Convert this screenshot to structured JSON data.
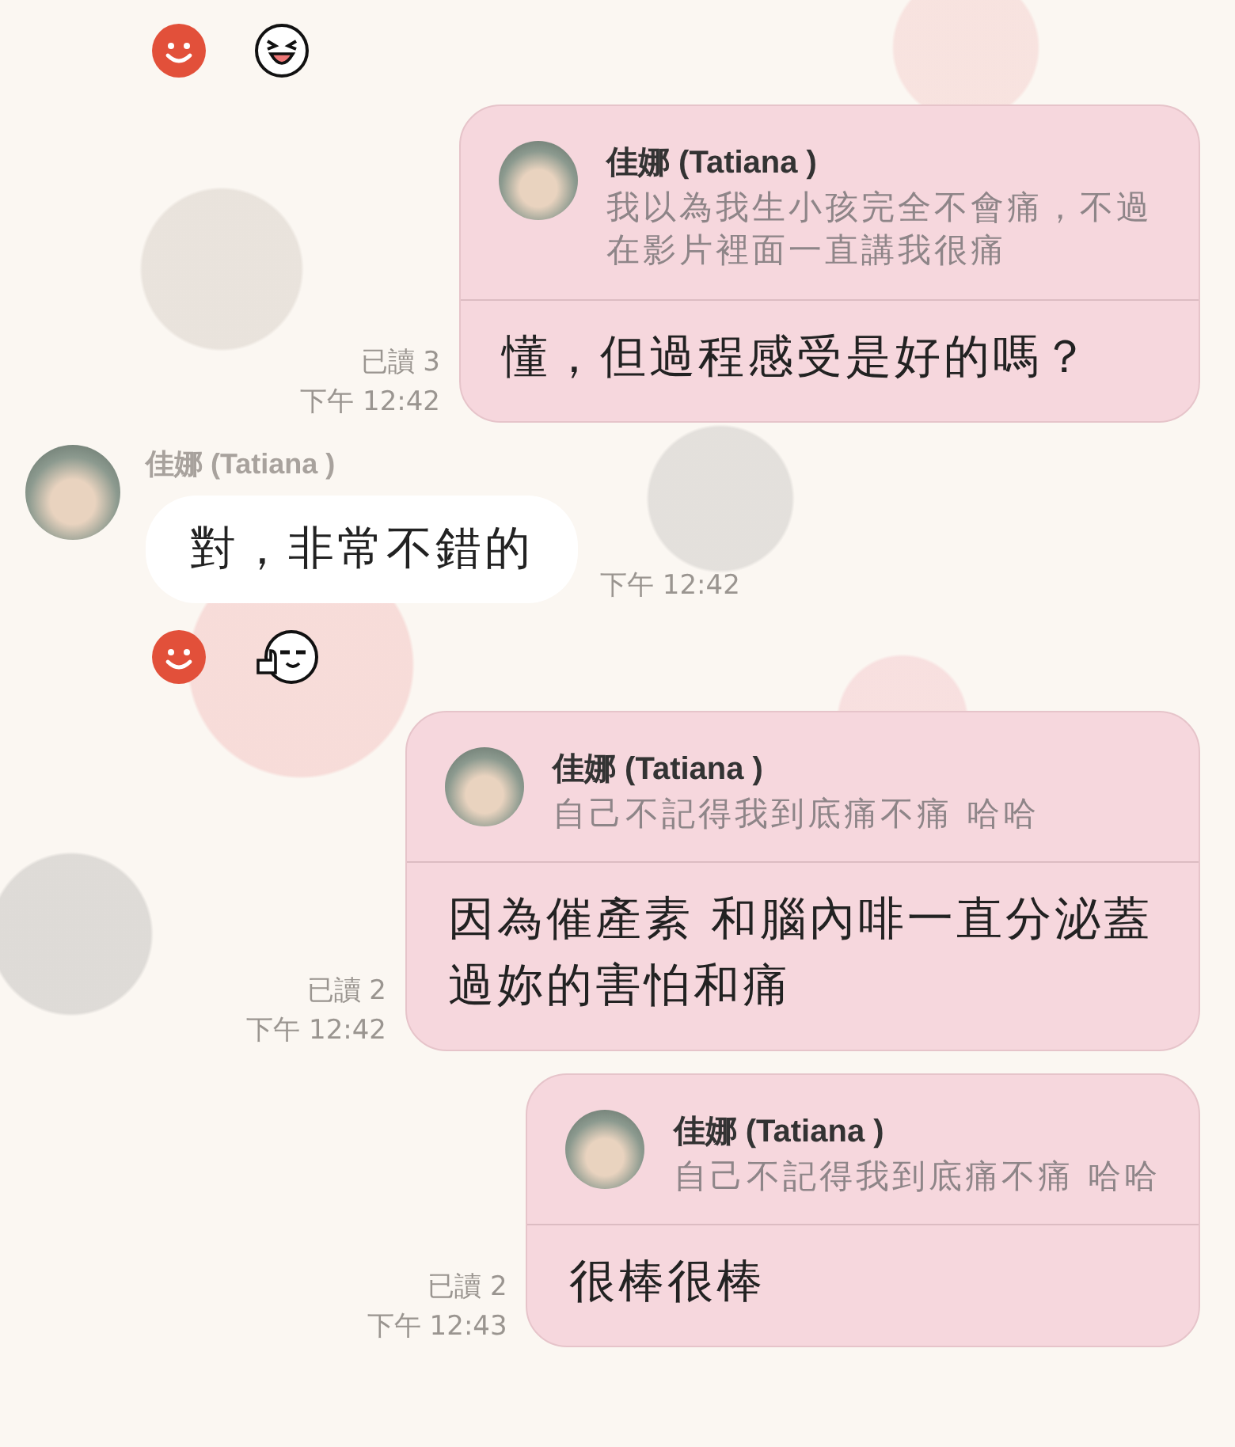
{
  "messages": [
    {
      "kind": "reactions"
    },
    {
      "kind": "sent_reply",
      "read_status": "已讀 3",
      "time": "下午 12:42",
      "quote": {
        "name": "佳娜 (Tatiana )",
        "text": "我以為我生小孩完全不會痛，不過在影片裡面一直講我很痛"
      },
      "text": "懂，但過程感受是好的嗎？"
    },
    {
      "kind": "received",
      "sender": "佳娜 (Tatiana )",
      "time": "下午 12:42",
      "text": "對，非常不錯的"
    },
    {
      "kind": "reactions"
    },
    {
      "kind": "sent_reply",
      "read_status": "已讀 2",
      "time": "下午 12:42",
      "quote": {
        "name": "佳娜 (Tatiana )",
        "text": "自己不記得我到底痛不痛 哈哈"
      },
      "text": "因為催產素 和腦內啡一直分泌蓋過妳的害怕和痛"
    },
    {
      "kind": "sent_reply",
      "read_status": "已讀 2",
      "time": "下午 12:43",
      "quote": {
        "name": "佳娜 (Tatiana )",
        "text": "自己不記得我到底痛不痛 哈哈"
      },
      "text": "很棒很棒"
    }
  ]
}
